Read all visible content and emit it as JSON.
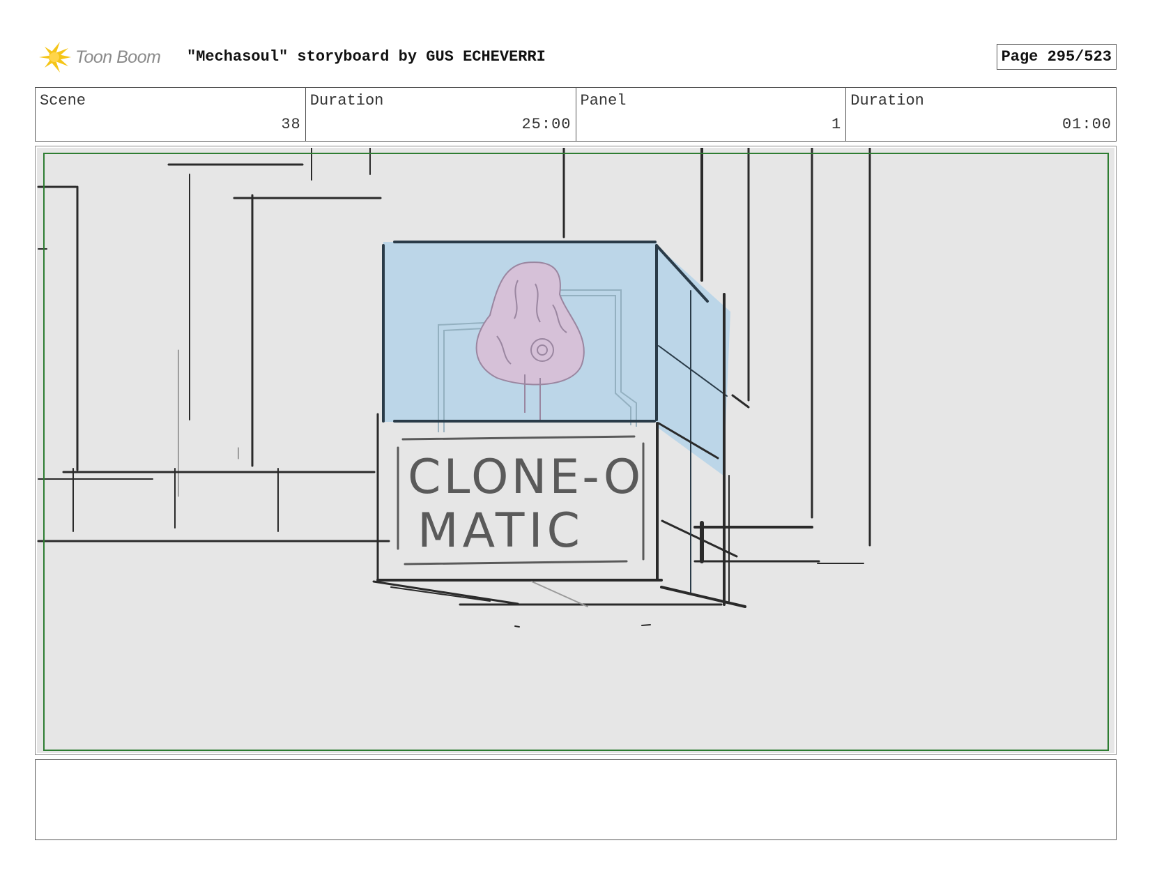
{
  "header": {
    "logo_text": "Toon Boom",
    "title": "\"Mechasoul\" storyboard by GUS ECHEVERRI",
    "page_label": "Page 295/523"
  },
  "info": {
    "scene_label": "Scene",
    "scene_value": "38",
    "scene_duration_label": "Duration",
    "scene_duration_value": "25:00",
    "panel_label": "Panel",
    "panel_value": "1",
    "panel_duration_label": "Duration",
    "panel_duration_value": "01:00"
  },
  "panel": {
    "sign_line_1": "CLONE-O",
    "sign_line_2": "MATIC"
  },
  "notes": {
    "text": ""
  },
  "colors": {
    "safe_frame": "#2e7d32",
    "glass": "#bcd6e8",
    "brain": "#d6c1d8",
    "ink": "#2a2a2a",
    "logo_burst": "#f5c518"
  }
}
